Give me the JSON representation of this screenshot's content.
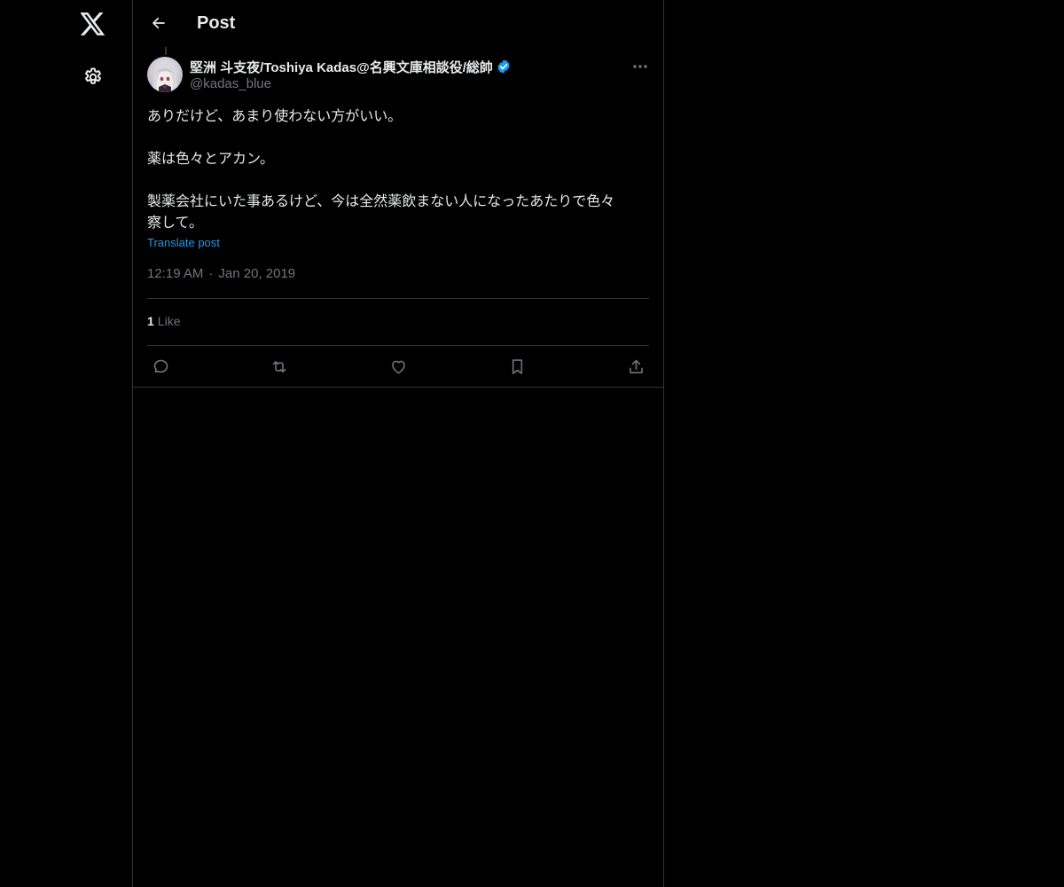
{
  "nav": {
    "logo_icon": "x-logo-icon",
    "settings_icon": "gear-icon"
  },
  "header": {
    "title": "Post"
  },
  "post": {
    "author_name": "堅洲 斗支夜/Toshiya Kadas@名興文庫相談役/総帥",
    "author_handle": "@kadas_blue",
    "verified": true,
    "body": [
      "ありだけど、あまり使わない方がいい。",
      "薬は色々とアカン。",
      "製薬会社にいた事あるけど、今は全然薬飲まない人になったあたりで色々",
      "察して。"
    ],
    "translate_label": "Translate post",
    "time": "12:19 AM",
    "separator": "·",
    "date": "Jan 20, 2019",
    "likes_count": "1",
    "likes_label": "Like"
  },
  "actions": {
    "reply": "reply-icon",
    "repost": "repost-icon",
    "like": "heart-icon",
    "bookmark": "bookmark-icon",
    "share": "share-icon"
  },
  "colors": {
    "background": "#000000",
    "text": "#e7e9ea",
    "muted": "#71767b",
    "accent": "#1d9bf0",
    "border": "#2f3336"
  }
}
